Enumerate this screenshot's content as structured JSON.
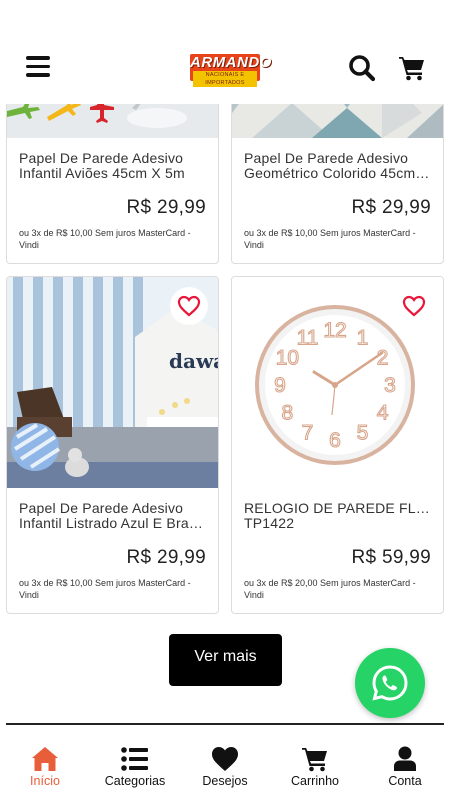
{
  "header": {
    "logo": {
      "brand": "ARMANDO",
      "tagline": "NACIONAIS E IMPORTADOS"
    }
  },
  "products": [
    {
      "name_line1": "Papel De Parede Adesivo",
      "name_line2": "Infantil Aviões 45cm X 5m",
      "price": "R$ 29,99",
      "installments": "ou 3x de R$ 10,00 Sem juros MasterCard - Vindi"
    },
    {
      "name_line1": "Papel De Parede Adesivo",
      "name_line2": "Geométrico Colorido 45cm X 5m",
      "price": "R$ 29,99",
      "installments": "ou 3x de R$ 10,00 Sem juros MasterCard - Vindi"
    },
    {
      "name_line1": "Papel De Parede Adesivo",
      "name_line2": "Infantil Listrado Azul E Branco",
      "price": "R$ 29,99",
      "installments": "ou 3x de R$ 10,00 Sem juros MasterCard - Vindi",
      "image_text": "dawa"
    },
    {
      "name_line1": "RELOGIO DE PAREDE FLOW",
      "name_line2": "TP1422",
      "price": "R$ 59,99",
      "installments": "ou 3x de R$ 20,00 Sem juros MasterCard - Vindi",
      "clock_numbers": [
        "12",
        "1",
        "2",
        "3",
        "4",
        "5",
        "6",
        "7",
        "8",
        "9",
        "10",
        "11"
      ]
    }
  ],
  "load_more_label": "Ver mais",
  "bottom_nav": [
    {
      "label": "Início",
      "icon": "home-icon",
      "active": true
    },
    {
      "label": "Categorias",
      "icon": "list-icon",
      "active": false
    },
    {
      "label": "Desejos",
      "icon": "heart-icon",
      "active": false
    },
    {
      "label": "Carrinho",
      "icon": "cart-icon",
      "active": false
    },
    {
      "label": "Conta",
      "icon": "user-icon",
      "active": false
    }
  ],
  "colors": {
    "accent": "#e85d3a",
    "whatsapp": "#25d366",
    "heart": "#e8173a",
    "logo_red": "#e8431a",
    "logo_yellow": "#f3c300"
  }
}
